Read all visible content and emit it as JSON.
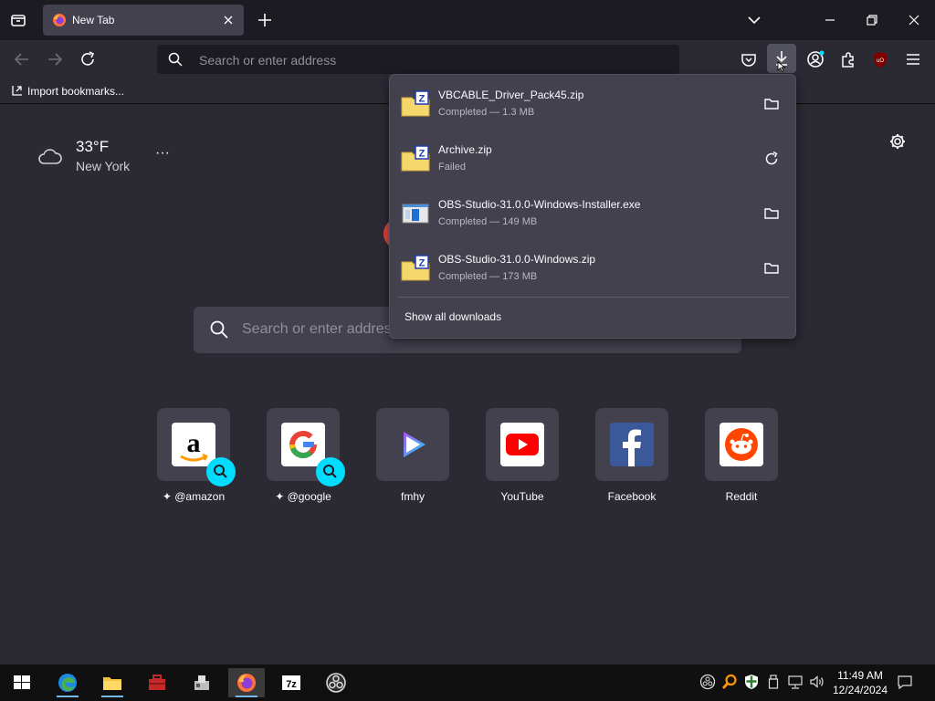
{
  "browser": {
    "tab": {
      "title": "New Tab",
      "close_icon": "close-icon"
    },
    "nav": {
      "url_placeholder": "Search or enter address"
    },
    "bookmarks": {
      "import_label": "Import bookmarks..."
    }
  },
  "newtab": {
    "weather": {
      "temperature": "33°F",
      "city": "New York",
      "more": "···"
    },
    "search_placeholder": "Search or enter address",
    "shortcuts": [
      {
        "label": "@amazon",
        "icon": "amazon-logo"
      },
      {
        "label": "@google",
        "icon": "google-logo"
      },
      {
        "label": "fmhy",
        "icon": "fmhy-logo"
      },
      {
        "label": "YouTube",
        "icon": "youtube-logo"
      },
      {
        "label": "Facebook",
        "icon": "facebook-logo"
      },
      {
        "label": "Reddit",
        "icon": "reddit-logo"
      }
    ]
  },
  "downloads": {
    "items": [
      {
        "name": "VBCABLE_Driver_Pack45.zip",
        "status": "Completed — 1.3 MB",
        "action": "folder-icon"
      },
      {
        "name": "Archive.zip",
        "status": "Failed",
        "action": "retry-icon"
      },
      {
        "name": "OBS-Studio-31.0.0-Windows-Installer.exe",
        "status": "Completed — 149 MB",
        "action": "folder-icon"
      },
      {
        "name": "OBS-Studio-31.0.0-Windows.zip",
        "status": "Completed — 173 MB",
        "action": "folder-icon"
      }
    ],
    "show_all": "Show all downloads"
  },
  "taskbar": {
    "clock_time": "11:49 AM",
    "clock_date": "12/24/2024"
  },
  "colors": {
    "accent": "#00ddff",
    "panel": "#42414d",
    "background": "#2b2a33"
  }
}
